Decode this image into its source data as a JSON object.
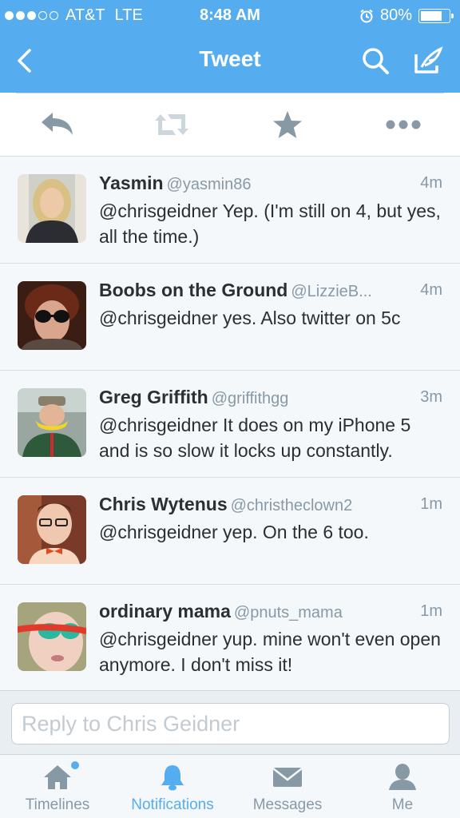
{
  "status": {
    "carrier": "AT&T",
    "network": "LTE",
    "time": "8:48 AM",
    "battery": "80%",
    "battery_level": 0.8,
    "signal_bars_filled": 3,
    "signal_bars_total": 5
  },
  "nav": {
    "title": "Tweet",
    "back_icon": "chevron-left-icon",
    "search_icon": "search-icon",
    "compose_icon": "compose-icon"
  },
  "actions": {
    "reply_icon": "reply-icon",
    "retweet_icon": "retweet-icon",
    "favorite_icon": "star-icon",
    "more_icon": "more-icon"
  },
  "replies": [
    {
      "name": "Yasmin",
      "handle": "@yasmin86",
      "time": "4m",
      "text": "@chrisgeidner Yep. (I'm still on 4, but yes, all the time.)"
    },
    {
      "name": "Boobs on the Ground",
      "handle": "@LizzieB...",
      "time": "4m",
      "text": "@chrisgeidner yes. Also twitter on 5c"
    },
    {
      "name": "Greg Griffith",
      "handle": "@griffithgg",
      "time": "3m",
      "text": "@chrisgeidner It does on my iPhone 5 and is so slow it locks up constantly."
    },
    {
      "name": "Chris Wytenus",
      "handle": "@christheclown2",
      "time": "1m",
      "text": "@chrisgeidner yep. On the 6 too."
    },
    {
      "name": "ordinary mama",
      "handle": "@pnuts_mama",
      "time": "1m",
      "text": "@chrisgeidner yup. mine won't even open anymore. I don't miss it!"
    }
  ],
  "reply_box": {
    "placeholder": "Reply to Chris Geidner"
  },
  "tabs": [
    {
      "label": "Timelines",
      "icon": "home-icon"
    },
    {
      "label": "Notifications",
      "icon": "bell-icon"
    },
    {
      "label": "Messages",
      "icon": "envelope-icon"
    },
    {
      "label": "Me",
      "icon": "person-icon"
    }
  ],
  "colors": {
    "brand": "#55acee",
    "text": "#292f33",
    "muted": "#8899a6",
    "icon_gray": "#8899a6"
  }
}
